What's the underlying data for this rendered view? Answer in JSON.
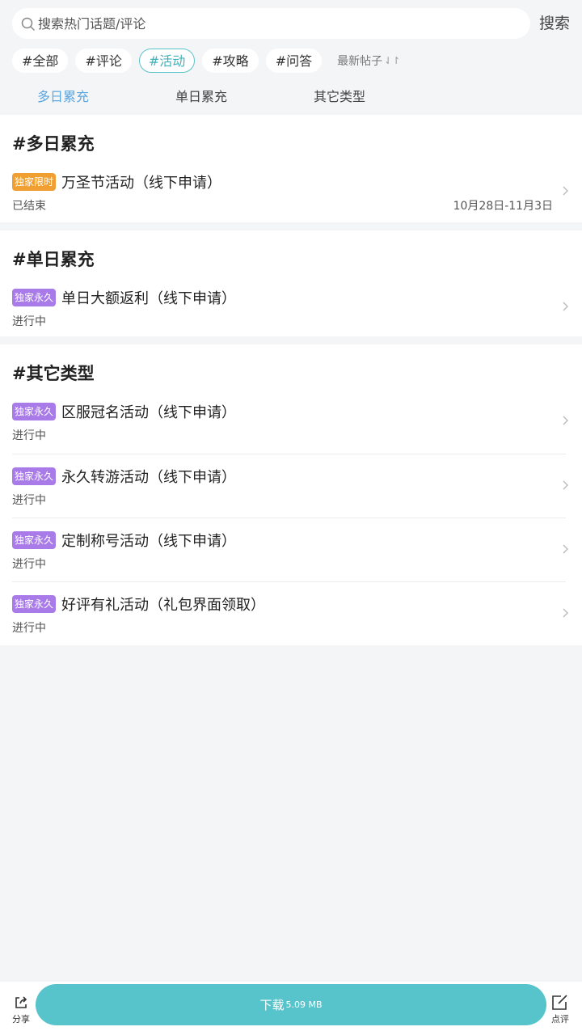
{
  "search": {
    "placeholder": "搜索热门话题/评论",
    "button": "搜索"
  },
  "tags": [
    "#全部",
    "#评论",
    "#活动",
    "#攻略",
    "#问答"
  ],
  "active_tag": "#活动",
  "sort_label": "最新帖子",
  "subtabs": [
    "多日累充",
    "单日累充",
    "其它类型"
  ],
  "active_subtab": "多日累充",
  "sections": [
    {
      "title": "#多日累充",
      "items": [
        {
          "badge": "独家限时",
          "badge_color": "#f0a033",
          "name": "万圣节活动（线下申请）",
          "status": "已结束",
          "date": "10月28日-11月3日"
        }
      ]
    },
    {
      "title": "#单日累充",
      "items": [
        {
          "badge": "独家永久",
          "badge_color": "#a87be8",
          "name": "单日大额返利（线下申请）",
          "status": "进行中",
          "date": ""
        }
      ]
    },
    {
      "title": "#其它类型",
      "items": [
        {
          "badge": "独家永久",
          "badge_color": "#a87be8",
          "name": "区服冠名活动（线下申请）",
          "status": "进行中",
          "date": ""
        },
        {
          "badge": "独家永久",
          "badge_color": "#a87be8",
          "name": "永久转游活动（线下申请）",
          "status": "进行中",
          "date": ""
        },
        {
          "badge": "独家永久",
          "badge_color": "#a87be8",
          "name": "定制称号活动（线下申请）",
          "status": "进行中",
          "date": ""
        },
        {
          "badge": "独家永久",
          "badge_color": "#a87be8",
          "name": "好评有礼活动（礼包界面领取）",
          "status": "进行中",
          "date": ""
        }
      ]
    }
  ],
  "bottom": {
    "share": "分享",
    "download": "下载",
    "download_size": "5.09 MB",
    "review": "点评"
  },
  "colors": {
    "accent": "#57c4cb",
    "tab_active": "#5aa6e0"
  }
}
